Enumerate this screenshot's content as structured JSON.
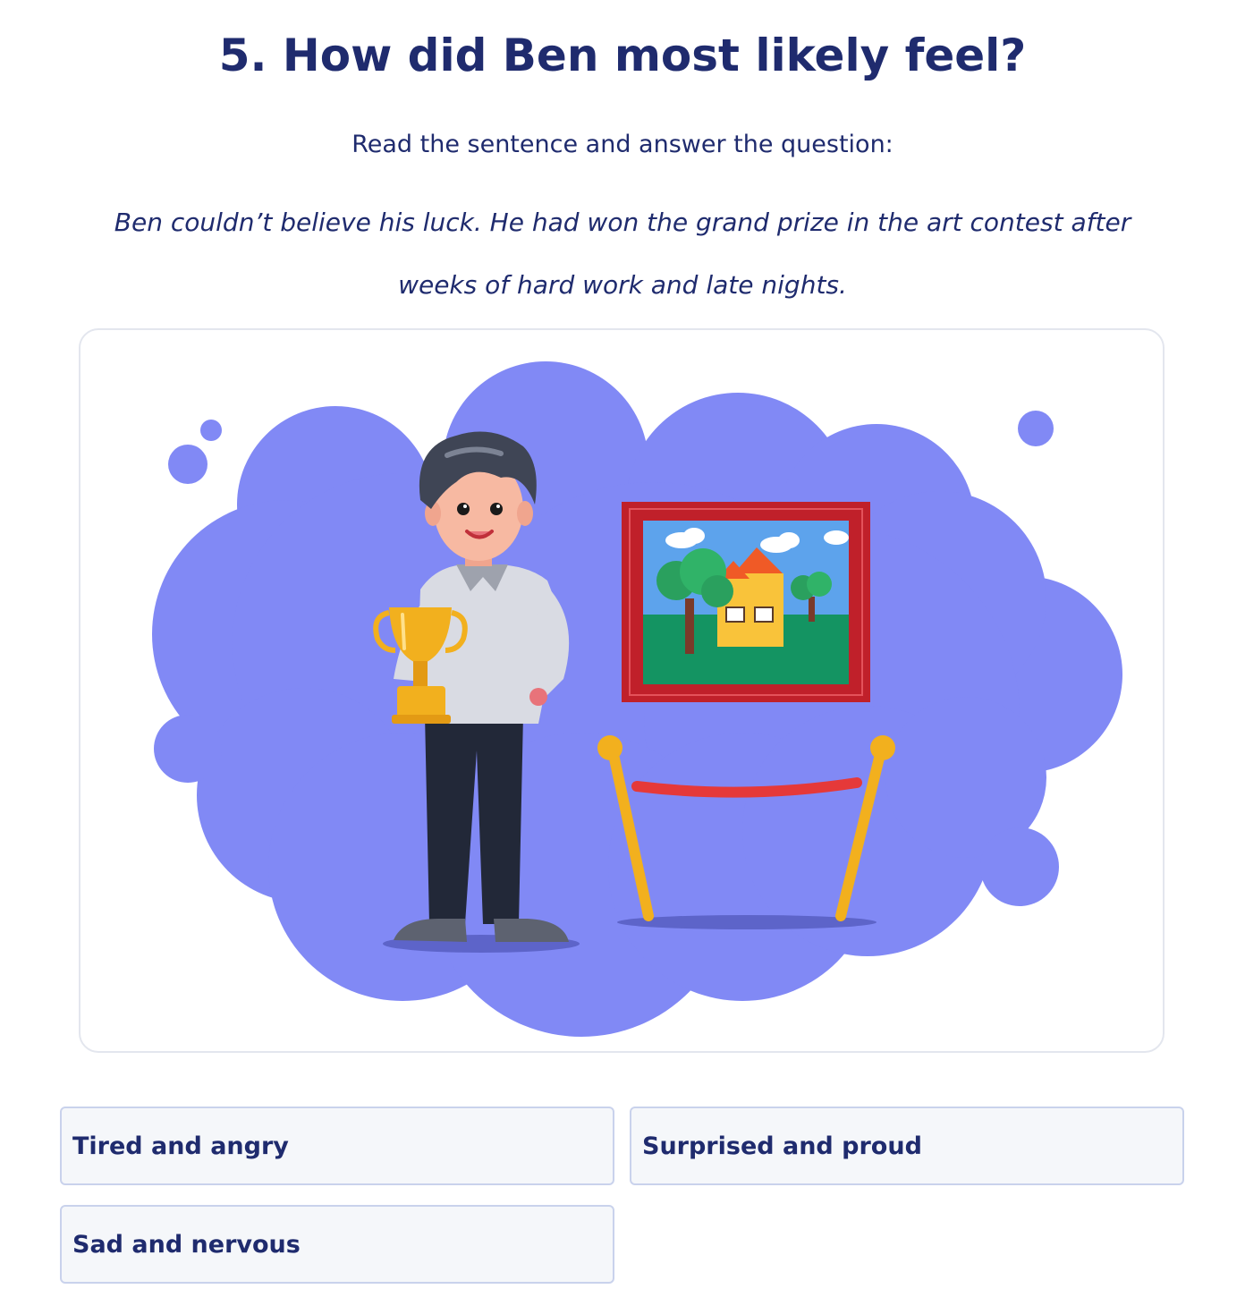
{
  "question": {
    "title": "5. How did Ben most likely feel?",
    "instruction": "Read the sentence and answer the question:",
    "passage": "Ben couldn’t believe his luck. He had won the grand prize in the art contest after weeks of hard work and late nights."
  },
  "illustration": {
    "subject": "boy holding a gold trophy next to a framed painting",
    "colors": {
      "cloud": "#8189f5",
      "frame": "#c0202a",
      "trophy": "#f2b01e",
      "rope": "#e53939"
    }
  },
  "options": [
    {
      "label": "Tired and angry"
    },
    {
      "label": "Surprised and proud"
    },
    {
      "label": "Sad and nervous"
    }
  ]
}
